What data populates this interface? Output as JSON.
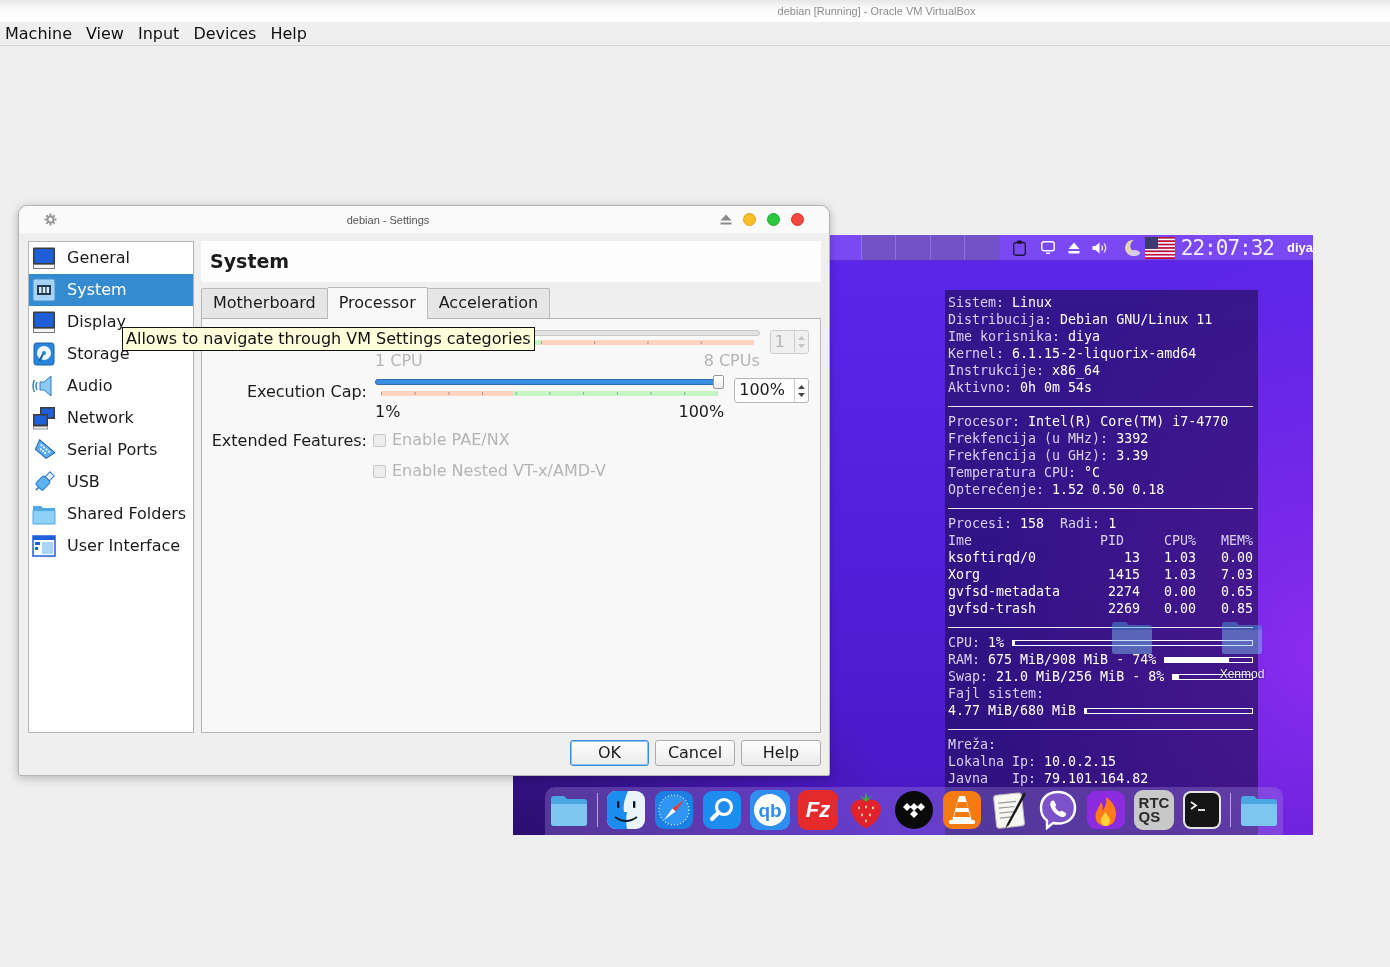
{
  "host_window": {
    "title": "debian [Running] - Oracle VM VirtualBox"
  },
  "menu": [
    "Machine",
    "View",
    "Input",
    "Devices",
    "Help"
  ],
  "guest": {
    "panel": {
      "workspaces": [
        {
          "selected": false
        },
        {
          "selected": false
        },
        {
          "selected": false
        },
        {
          "selected": false
        }
      ],
      "tray": [
        {
          "kind": "clipboard"
        },
        {
          "kind": "display"
        },
        {
          "kind": "eject"
        },
        {
          "kind": "volume"
        },
        {
          "kind": "moon"
        },
        {
          "kind": "flag"
        }
      ],
      "clock": "22:07:32",
      "user": "diya"
    },
    "desktop_icons": [
      {
        "kind": "folder"
      },
      {
        "kind": "folder",
        "label": "Xenmod"
      }
    ],
    "monitor": {
      "sections": [
        {
          "kind": "lines",
          "lines": [
            {
              "label": "Sistem:",
              "value": "Linux"
            },
            {
              "label": "Distribucija:",
              "value": "Debian GNU/Linux 11"
            },
            {
              "label": "Ime korisnika:",
              "value": "diya"
            },
            {
              "label": "Kernel:",
              "value": "6.1.15-2-liquorix-amd64"
            },
            {
              "label": "Instrukcije:",
              "value": "x86_64"
            },
            {
              "label": "Aktivno:",
              "value": "0h 0m 54s"
            }
          ]
        },
        {
          "kind": "lines",
          "lines": [
            {
              "label": "Procesor:",
              "value": "Intel(R) Core(TM) i7-4770"
            },
            {
              "label": "Frekfencija (u MHz):",
              "value": "3392"
            },
            {
              "label": "Frekfencija (u GHz):",
              "value": "3.39"
            },
            {
              "label": "Temperatura CPU:",
              "value": "°C"
            },
            {
              "label": "Opterećenje:",
              "value": "1.52 0.50 0.18"
            }
          ]
        },
        {
          "kind": "processes",
          "summary": [
            {
              "label": "Procesi:",
              "value": "158"
            },
            {
              "label": "Radi:",
              "value": "1"
            }
          ],
          "columns": [
            "Ime",
            "PID",
            "CPU%",
            "MEM%"
          ],
          "rows": [
            [
              "ksoftirqd/0",
              "13",
              "1.03",
              "0.00"
            ],
            [
              "Xorg",
              "1415",
              "1.03",
              "7.03"
            ],
            [
              "gvfsd-metadata",
              "2274",
              "0.00",
              "0.65"
            ],
            [
              "gvfsd-trash",
              "2269",
              "0.00",
              "0.85"
            ]
          ]
        },
        {
          "kind": "usage",
          "lines": [
            {
              "label": "CPU:",
              "value": "1%",
              "level": 0.01
            },
            {
              "label": "RAM:",
              "value": "675 MiB/908 MiB - 74%",
              "level": 0.74
            },
            {
              "label": "Swap:",
              "value": "21.0 MiB/256 MiB - 8%",
              "level": 0.08
            },
            {
              "label": "Fajl sistem:"
            },
            {
              "value": "4.77 MiB/680 MiB",
              "level": 0.01
            }
          ]
        },
        {
          "kind": "lines",
          "lines": [
            {
              "label": "Mreža:"
            },
            {
              "label": "Lokalna Ip:",
              "value": "10.0.2.15"
            },
            {
              "label": "Javna   Ip:",
              "value": "79.101.164.82"
            }
          ]
        }
      ]
    },
    "dock": [
      {
        "kind": "folder"
      },
      {
        "kind": "divider"
      },
      {
        "kind": "face"
      },
      {
        "kind": "compass"
      },
      {
        "kind": "search"
      },
      {
        "kind": "ring-letters",
        "lines": [
          "qb"
        ],
        "color": "#2f8ef0"
      },
      {
        "kind": "letters",
        "lines": [
          "Fz"
        ],
        "color": "#e42a2a"
      },
      {
        "kind": "strawberry"
      },
      {
        "kind": "diamonds"
      },
      {
        "kind": "cone"
      },
      {
        "kind": "notepad"
      },
      {
        "kind": "phone-bubble"
      },
      {
        "kind": "flame"
      },
      {
        "kind": "stacked-letters",
        "lines": [
          "RTC",
          "QS"
        ],
        "color": "#c8c8c8"
      },
      {
        "kind": "terminal"
      },
      {
        "kind": "divider"
      },
      {
        "kind": "folder"
      }
    ]
  },
  "settings_dialog": {
    "title": "debian - Settings",
    "categories": [
      {
        "label": "General",
        "kind": "monitor",
        "selected": false
      },
      {
        "label": "System",
        "kind": "chip",
        "selected": true
      },
      {
        "label": "Display",
        "kind": "monitor",
        "selected": false
      },
      {
        "label": "Storage",
        "kind": "disk",
        "selected": false
      },
      {
        "label": "Audio",
        "kind": "speaker",
        "selected": false
      },
      {
        "label": "Network",
        "kind": "network",
        "selected": false
      },
      {
        "label": "Serial Ports",
        "kind": "serial",
        "selected": false
      },
      {
        "label": "USB",
        "kind": "usb",
        "selected": false
      },
      {
        "label": "Shared Folders",
        "kind": "folder",
        "selected": false
      },
      {
        "label": "User Interface",
        "kind": "window",
        "selected": false
      }
    ],
    "page_title": "System",
    "tabs": [
      {
        "label": "Motherboard",
        "selected": false
      },
      {
        "label": "Processor",
        "selected": true
      },
      {
        "label": "Acceleration",
        "selected": false
      }
    ],
    "processor": {
      "cpu": {
        "value": "1",
        "disabled": true,
        "min_label": "1 CPU",
        "max_label": "8 CPUs",
        "zones": [
          {
            "color": "#c4f5c4",
            "level": 0.43
          },
          {
            "color": "#fdd3c2",
            "level": 0.57
          }
        ]
      },
      "execution_cap": {
        "label": "Execution Cap:",
        "value": "100%",
        "level": 1,
        "min_label": "1%",
        "max_label": "100%",
        "zones": [
          {
            "color": "#fdd3c2",
            "level": 0.39
          },
          {
            "color": "#c4f5c4",
            "level": 0.61
          }
        ]
      },
      "extended_features": {
        "label": "Extended Features:",
        "options": [
          {
            "label": "Enable PAE/NX",
            "checked": false,
            "disabled": true
          },
          {
            "label": "Enable Nested VT-x/AMD-V",
            "checked": false,
            "disabled": true
          }
        ]
      }
    },
    "tooltip": "Allows to navigate through VM Settings categories",
    "buttons": [
      {
        "label": "OK",
        "default": true
      },
      {
        "label": "Cancel",
        "default": false
      },
      {
        "label": "Help",
        "default": false
      }
    ]
  }
}
